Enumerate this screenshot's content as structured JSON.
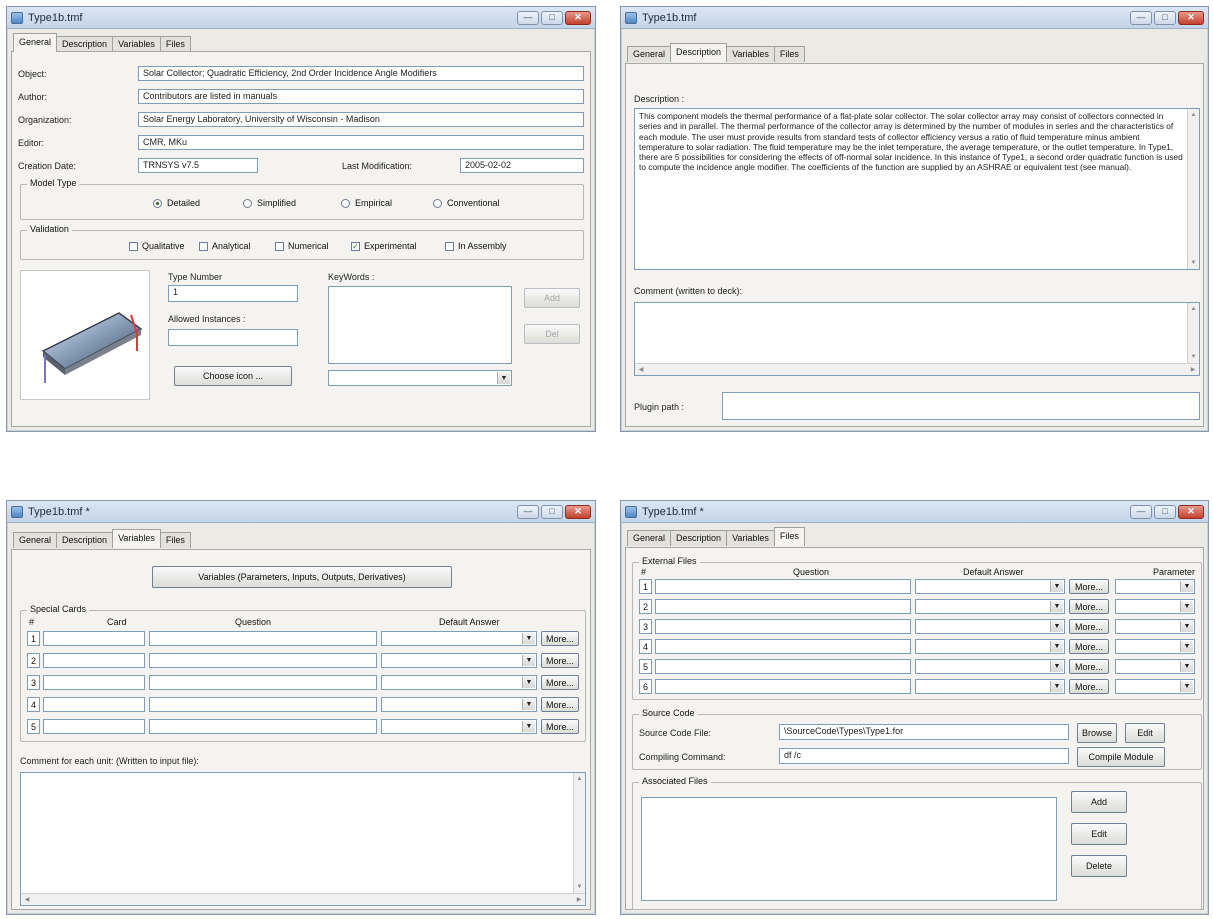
{
  "tabs": [
    "General",
    "Description",
    "Variables",
    "Files"
  ],
  "win1": {
    "title": "Type1b.tmf",
    "rows": [
      {
        "label": "Object:",
        "value": "Solar Collector; Quadratic Efficiency, 2nd Order Incidence Angle Modifiers"
      },
      {
        "label": "Author:",
        "value": "Contributors are listed in manuals"
      },
      {
        "label": "Organization:",
        "value": "Solar Energy Laboratory, University of Wisconsin - Madison"
      },
      {
        "label": "Editor:",
        "value": "CMR, MKu"
      }
    ],
    "creation_date_label": "Creation Date:",
    "creation_date": "TRNSYS v7.5",
    "last_mod_label": "Last Modification:",
    "last_mod": "2005-02-02",
    "model_type_label": "Model Type",
    "model_types": [
      "Detailed",
      "Simplified",
      "Empirical",
      "Conventional"
    ],
    "model_type_selected": "Detailed",
    "validation_label": "Validation",
    "validations": [
      "Qualitative",
      "Analytical",
      "Numerical",
      "Experimental",
      "In Assembly"
    ],
    "validation_checked": [
      "Experimental"
    ],
    "type_number_label": "Type Number",
    "type_number": "1",
    "allowed_instances_label": "Allowed Instances :",
    "allowed_instances": "",
    "choose_icon": "Choose icon ...",
    "keywords_label": "KeyWords :",
    "add_btn": "Add",
    "del_btn": "Del"
  },
  "win2": {
    "title": "Type1b.tmf",
    "description_label": "Description :",
    "description": "This component models the thermal performance of a flat-plate solar collector. The solar collector array may consist of collectors connected in series and in parallel.  The thermal performance of the collector array is determined by the number of modules in series and the characteristics of each module. The user must provide results from standard tests of collector efficiency versus a ratio of fluid temperature minus ambient temperature to solar radiation. The fluid temperature may be the inlet temperature, the average temperature, or the outlet temperature.  In Type1, there are 5 possibilities for considering the effects of off-normal solar incidence. In this instance of Type1, a second order quadratic function is used to compute the incidence angle modifier. The coefficients of the function are supplied by an ASHRAE or equivalent test (see manual).",
    "comment_label": "Comment (written to deck):",
    "plugin_label": "Plugin path :"
  },
  "win3": {
    "title": "Type1b.tmf *",
    "variables_btn": "Variables (Parameters, Inputs, Outputs, Derivatives)",
    "special_cards_label": "Special Cards",
    "col_hash": "#",
    "col_card": "Card",
    "col_question": "Question",
    "col_default": "Default Answer",
    "row_numbers": [
      "1",
      "2",
      "3",
      "4",
      "5"
    ],
    "more_label": "More...",
    "comment_label": "Comment for each unit: (Written to input file):"
  },
  "win4": {
    "title": "Type1b.tmf *",
    "external_files_label": "External Files",
    "col_hash": "#",
    "col_question": "Question",
    "col_default": "Default Answer",
    "col_parameter": "Parameter",
    "row_numbers": [
      "1",
      "2",
      "3",
      "4",
      "5",
      "6"
    ],
    "more_label": "More...",
    "source_code_label": "Source Code",
    "source_file_label": "Source Code File:",
    "source_file": "\\SourceCode\\Types\\Type1.for",
    "browse_btn": "Browse",
    "edit_btn": "Edit",
    "compiling_label": "Compiling Command:",
    "compiling": "df /c",
    "compile_btn": "Compile Module",
    "associated_label": "Associated Files",
    "add_btn": "Add",
    "edit2_btn": "Edit",
    "delete_btn": "Delete"
  }
}
